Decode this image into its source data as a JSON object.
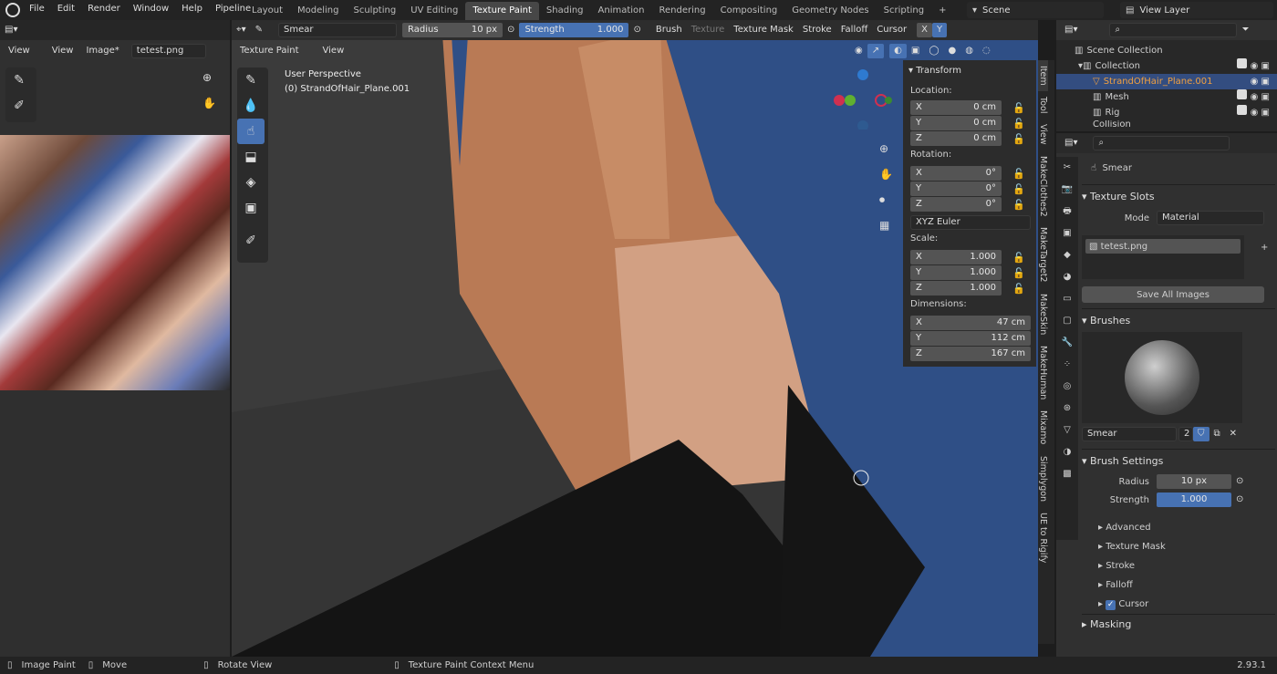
{
  "menubar": {
    "items": [
      "File",
      "Edit",
      "Render",
      "Window",
      "Help",
      "Pipeline"
    ]
  },
  "workspaces": [
    "Layout",
    "Modeling",
    "Sculpting",
    "UV Editing",
    "Texture Paint",
    "Shading",
    "Animation",
    "Rendering",
    "Compositing",
    "Geometry Nodes",
    "Scripting"
  ],
  "active_workspace": "Texture Paint",
  "scene": "Scene",
  "view_layer": "View Layer",
  "image_editor": {
    "view1": "View",
    "view2": "View",
    "image": "Image*",
    "image_name": "tetest.png"
  },
  "viewport": {
    "brush": "Smear",
    "radius_label": "Radius",
    "radius_value": "10 px",
    "strength_label": "Strength",
    "strength_value": "1.000",
    "menus": [
      "Brush",
      "Texture",
      "Texture Mask",
      "Stroke",
      "Falloff",
      "Cursor"
    ],
    "mode": "Texture Paint",
    "view": "View",
    "perspective": "User Perspective",
    "object": "(0) StrandOfHair_Plane.001",
    "x_btn": "X",
    "y_btn": "Y"
  },
  "transform": {
    "title": "Transform",
    "location_label": "Location:",
    "location": [
      {
        "a": "X",
        "v": "0 cm"
      },
      {
        "a": "Y",
        "v": "0 cm"
      },
      {
        "a": "Z",
        "v": "0 cm"
      }
    ],
    "rotation_label": "Rotation:",
    "rotation": [
      {
        "a": "X",
        "v": "0°"
      },
      {
        "a": "Y",
        "v": "0°"
      },
      {
        "a": "Z",
        "v": "0°"
      }
    ],
    "euler": "XYZ Euler",
    "scale_label": "Scale:",
    "scale": [
      {
        "a": "X",
        "v": "1.000"
      },
      {
        "a": "Y",
        "v": "1.000"
      },
      {
        "a": "Z",
        "v": "1.000"
      }
    ],
    "dimensions_label": "Dimensions:",
    "dimensions": [
      {
        "a": "X",
        "v": "47 cm"
      },
      {
        "a": "Y",
        "v": "112 cm"
      },
      {
        "a": "Z",
        "v": "167 cm"
      }
    ]
  },
  "side_tabs": [
    "Item",
    "Tool",
    "View",
    "MakeClothes2",
    "MakeTarget2",
    "MakeSkin",
    "MakeHuman",
    "Mixamo",
    "Simplygon",
    "UE to Rigify"
  ],
  "outliner": {
    "items": [
      "Scene Collection",
      "Collection",
      "StrandOfHair_Plane.001",
      "Mesh",
      "Rig",
      "Collision"
    ]
  },
  "properties": {
    "brush_name": "Smear",
    "texture_slots": "Texture Slots",
    "mode_label": "Mode",
    "mode_value": "Material",
    "slot": "tetest.png",
    "save_all": "Save All Images",
    "brushes": "Brushes",
    "brush_field": "Smear",
    "brush_users": "2",
    "brush_settings": "Brush Settings",
    "radius_label": "Radius",
    "radius_value": "10 px",
    "strength_label": "Strength",
    "strength_value": "1.000",
    "sub": [
      "Advanced",
      "Texture Mask",
      "Stroke",
      "Falloff",
      "Cursor"
    ],
    "masking": "Masking"
  },
  "status": {
    "image_paint": "Image Paint",
    "move": "Move",
    "rotate": "Rotate View",
    "context": "Texture Paint Context Menu",
    "version": "2.93.1"
  }
}
